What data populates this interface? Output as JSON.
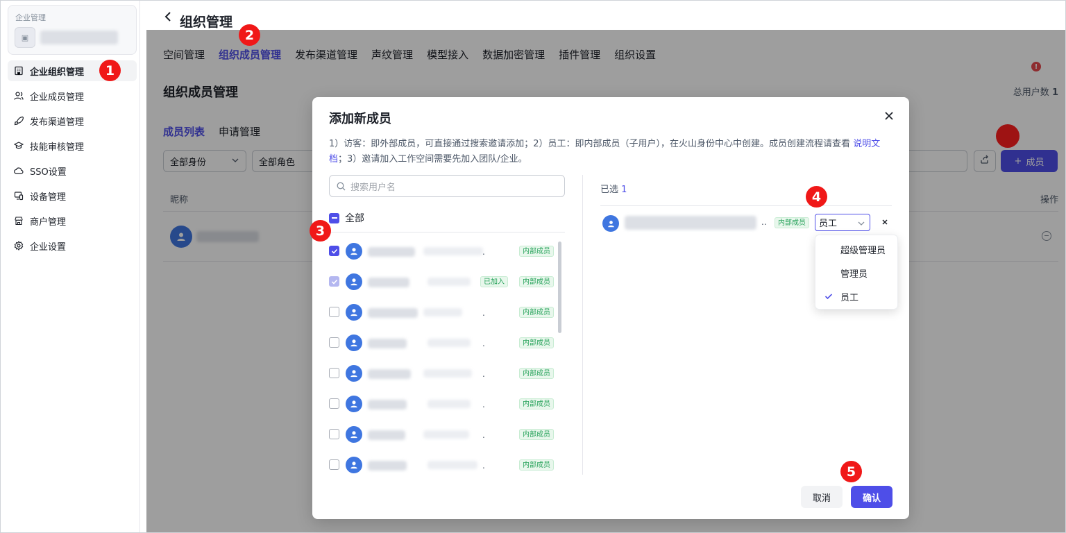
{
  "sidebar": {
    "enterprise_label": "企业管理",
    "logo_glyph": "▣",
    "items": [
      {
        "label": "企业组织管理",
        "icon": "building-icon",
        "active": true
      },
      {
        "label": "企业成员管理",
        "icon": "users-icon",
        "active": false
      },
      {
        "label": "发布渠道管理",
        "icon": "rocket-icon",
        "active": false
      },
      {
        "label": "技能审核管理",
        "icon": "graduation-cap-icon",
        "active": false
      },
      {
        "label": "SSO设置",
        "icon": "cloud-key-icon",
        "active": false
      },
      {
        "label": "设备管理",
        "icon": "device-icon",
        "active": false
      },
      {
        "label": "商户管理",
        "icon": "store-icon",
        "active": false
      },
      {
        "label": "企业设置",
        "icon": "gear-icon",
        "active": false
      }
    ]
  },
  "header": {
    "title": "组织管理",
    "back_icon": "chevron-left-icon"
  },
  "tabs": [
    "空间管理",
    "组织成员管理",
    "发布渠道管理",
    "声纹管理",
    "模型接入",
    "数据加密管理",
    "插件管理",
    "组织设置"
  ],
  "active_tab": 1,
  "alert_glyph": "!",
  "section": {
    "title": "组织成员管理",
    "total_label": "总用户数",
    "total_value": "1"
  },
  "subtabs": [
    "成员列表",
    "申请管理"
  ],
  "filters": {
    "identity": "全部身份",
    "role": "全部角色"
  },
  "add_button": {
    "plus": "+",
    "label": "成员"
  },
  "table": {
    "col_name": "昵称",
    "col_action": "操作"
  },
  "modal": {
    "title": "添加新成员",
    "desc_part1": "1）访客：即外部成员，可直接通过搜索邀请添加；2）员工：即内部成员（子用户），在火山身份中心中创建。成员创建流程请查看",
    "desc_link": "说明文档",
    "desc_part2": "；3）邀请加入工作空间需要先加入团队/企业。",
    "search_placeholder": "搜索用户名",
    "select_all_label": "全部",
    "members": [
      {
        "checked": true,
        "disabled": false,
        "dot": ".",
        "tags": [
          "内部成员"
        ]
      },
      {
        "checked": true,
        "disabled": true,
        "dot": "",
        "tags": [
          "已加入",
          "内部成员"
        ]
      },
      {
        "checked": false,
        "disabled": false,
        "dot": ".",
        "tags": [
          "内部成员"
        ]
      },
      {
        "checked": false,
        "disabled": false,
        "dot": ".",
        "tags": [
          "内部成员"
        ]
      },
      {
        "checked": false,
        "disabled": false,
        "dot": ".",
        "tags": [
          "内部成员"
        ]
      },
      {
        "checked": false,
        "disabled": false,
        "dot": ".",
        "tags": [
          "内部成员"
        ]
      },
      {
        "checked": false,
        "disabled": false,
        "dot": ".",
        "tags": [
          "内部成员"
        ]
      },
      {
        "checked": false,
        "disabled": false,
        "dot": ".",
        "tags": [
          "内部成员"
        ]
      }
    ],
    "selected_label": "已选",
    "selected_count": "1",
    "selected_member": {
      "ellipsis": "..",
      "tag": "内部成员",
      "role": "员工"
    },
    "role_options": [
      {
        "label": "超级管理员",
        "selected": false
      },
      {
        "label": "管理员",
        "selected": false
      },
      {
        "label": "员工",
        "selected": true
      }
    ],
    "cancel_label": "取消",
    "confirm_label": "确认"
  },
  "steps": [
    "1",
    "2",
    "3",
    "4",
    "5"
  ],
  "colors": {
    "accent": "#4e4ee8",
    "badge": "#f01818",
    "tag_green": "#26a25a",
    "avatar_blue": "#3f76e0"
  }
}
